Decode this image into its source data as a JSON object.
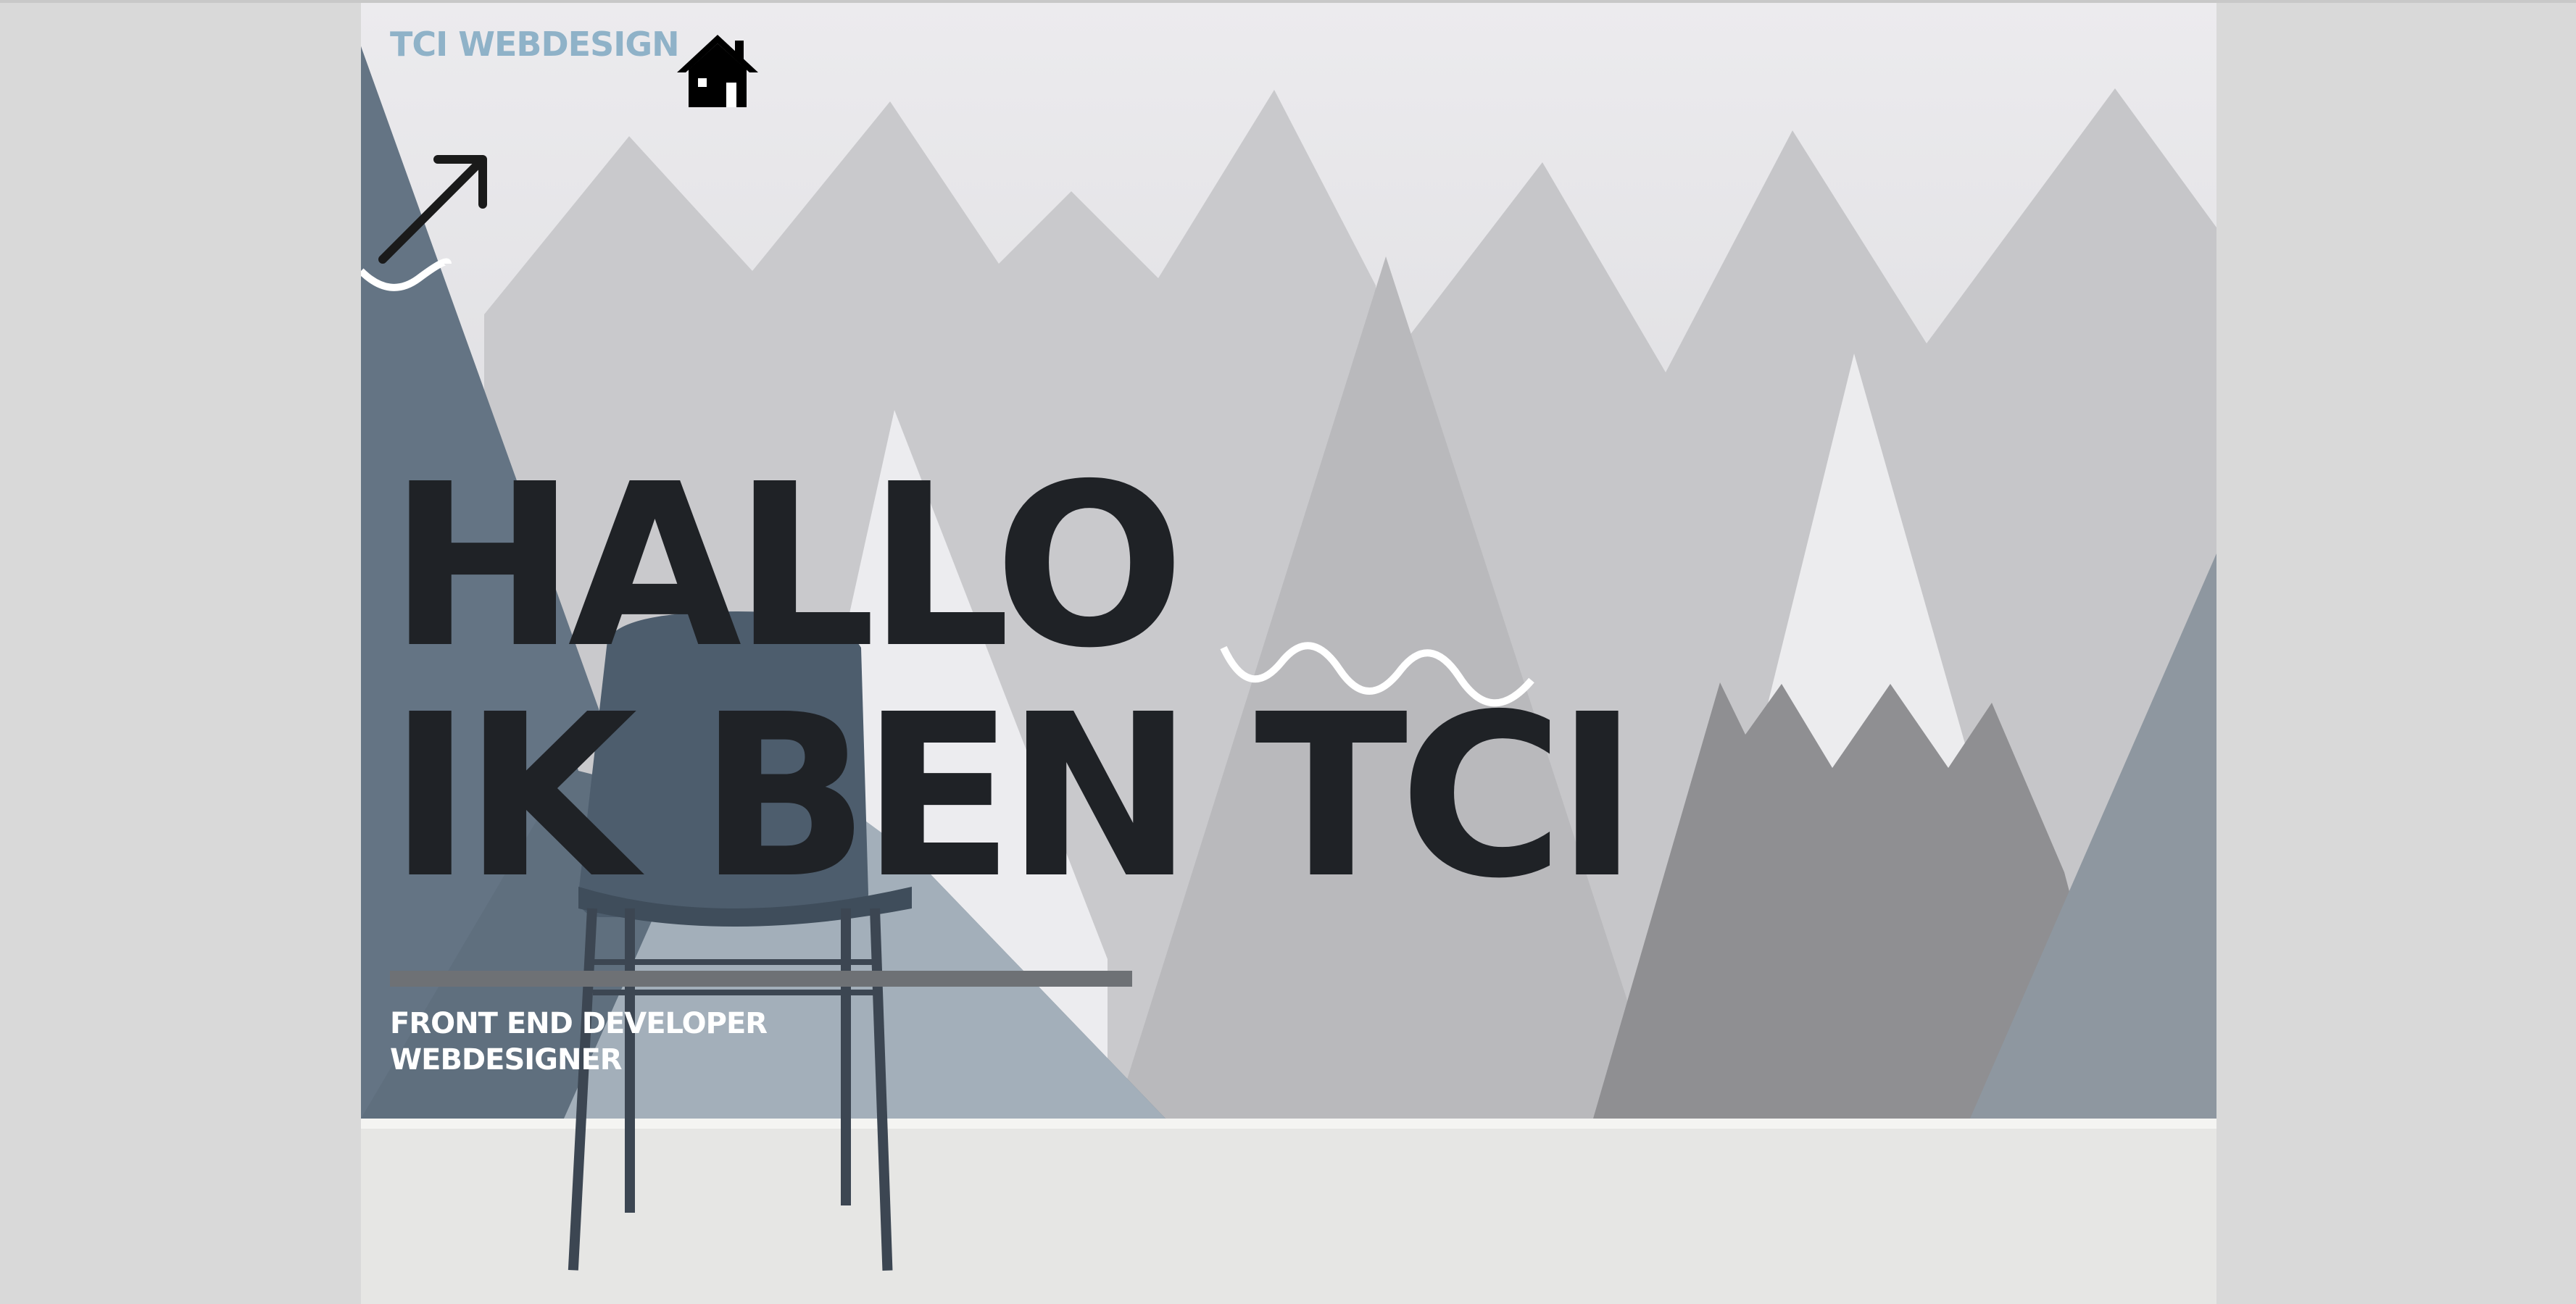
{
  "header": {
    "brand": "TCI WEBDESIGN",
    "home_icon": "house-icon",
    "arrow_icon": "arrow-up-right-icon"
  },
  "hero": {
    "headline_line1": "HALLO",
    "headline_line2": "IK BEN TCI",
    "role_1": "FRONT END DEVELOPER",
    "role_2": "WEBDESIGNER"
  },
  "colors": {
    "brand": "#8fb2c8",
    "headline": "#1f2226",
    "divider": "#6e7175",
    "roles": "#ffffff"
  }
}
